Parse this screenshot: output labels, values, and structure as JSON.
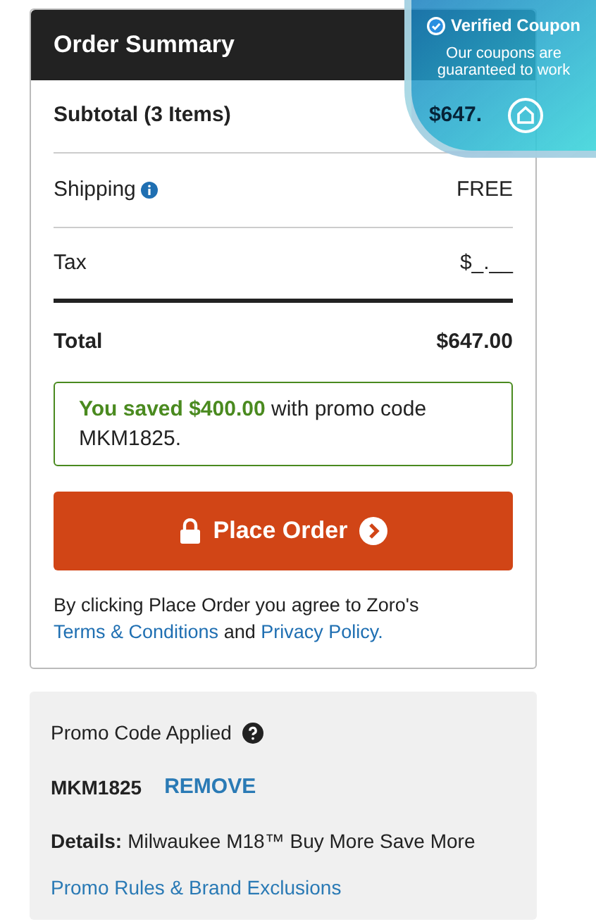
{
  "summary": {
    "title": "Order Summary",
    "rows": [
      {
        "kind": "subtotal",
        "label": "Subtotal (3 Items)",
        "value": "$647."
      },
      {
        "kind": "shipping",
        "label": "Shipping",
        "value": "FREE"
      },
      {
        "kind": "tax",
        "label": "Tax",
        "value": "$_.__"
      },
      {
        "kind": "total",
        "label": "Total",
        "value": "$647.00"
      }
    ],
    "savings": {
      "highlight": "You saved $400.00",
      "text": "with promo code MKM1825."
    },
    "place_order": {
      "label": "Place Order"
    },
    "terms": {
      "text": "By clicking Place Order you agree to Zoro's",
      "link1": "Terms & Conditions",
      "middle": "and",
      "link2": "Privacy Policy."
    }
  },
  "badge": {
    "title": "Verified Coupon",
    "text": "Our coupons are guaranteed to work"
  },
  "promo": {
    "heading": "Promo Code Applied",
    "code": "MKM1825",
    "remove": "REMOVE",
    "details_label": "Details:",
    "details": "Milwaukee M18™ Buy More Save More",
    "rules_link": "Promo Rules & Brand Exclusions"
  }
}
